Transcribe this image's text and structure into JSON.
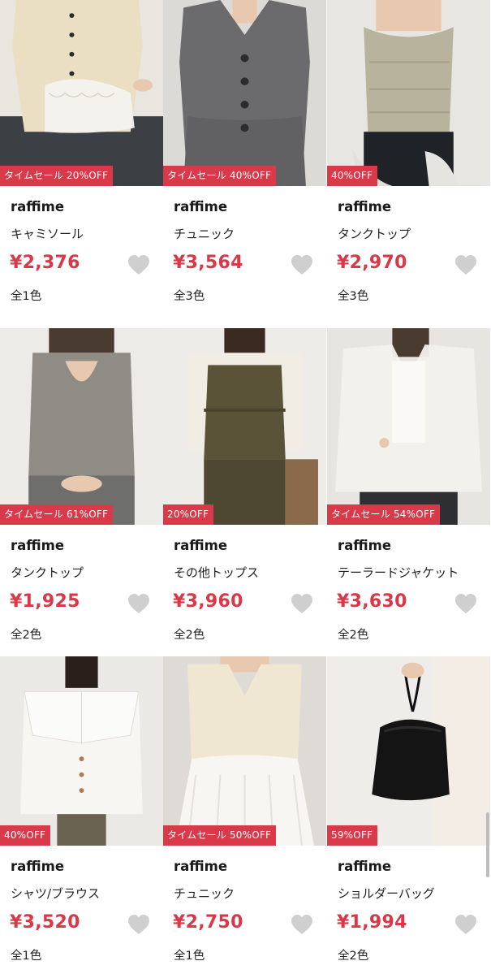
{
  "products": [
    {
      "badge": "タイムセール 20%OFF",
      "brand": "raffime",
      "category": "キャミソール",
      "price": "¥2,376",
      "colors": "全1色",
      "image": "cream-lace-knit-top",
      "bg": "#e9e5df"
    },
    {
      "badge": "タイムセール 40%OFF",
      "brand": "raffime",
      "category": "チュニック",
      "price": "¥3,564",
      "colors": "全3色",
      "image": "gray-knit-tunic",
      "bg": "#dcdad6"
    },
    {
      "badge": "40%OFF",
      "brand": "raffime",
      "category": "タンクトップ",
      "price": "¥2,970",
      "colors": "全3色",
      "image": "sage-knit-tank",
      "bg": "#e8e6e2"
    },
    {
      "badge": "タイムセール 61%OFF",
      "brand": "raffime",
      "category": "タンクトップ",
      "price": "¥1,925",
      "colors": "全2色",
      "image": "gray-backless-knit-tank",
      "bg": "#ecebe8"
    },
    {
      "badge": "20%OFF",
      "brand": "raffime",
      "category": "その他トップス",
      "price": "¥3,960",
      "colors": "全2色",
      "image": "olive-camisole-layered",
      "bg": "#eeece8"
    },
    {
      "badge": "タイムセール 54%OFF",
      "brand": "raffime",
      "category": "テーラードジャケット",
      "price": "¥3,630",
      "colors": "全2色",
      "image": "sheer-white-jacket",
      "bg": "#e7e5e1"
    },
    {
      "badge": "40%OFF",
      "brand": "raffime",
      "category": "シャツ/ブラウス",
      "price": "¥3,520",
      "colors": "全1色",
      "image": "white-sailor-collar-blouse",
      "bg": "#ebe9e6"
    },
    {
      "badge": "タイムセール 50%OFF",
      "brand": "raffime",
      "category": "チュニック",
      "price": "¥2,750",
      "colors": "全1色",
      "image": "ivory-knit-peplum-tunic",
      "bg": "#dedbd6"
    },
    {
      "badge": "59%OFF",
      "brand": "raffime",
      "category": "ショルダーバッグ",
      "price": "¥1,994",
      "colors": "全2色",
      "image": "black-drawstring-bag",
      "bg": "#efedea"
    }
  ],
  "icons": {
    "favorite": "heart-icon"
  },
  "colors": {
    "badge": "#d93a4a",
    "price": "#d83848",
    "heart": "#cfcfcf"
  }
}
